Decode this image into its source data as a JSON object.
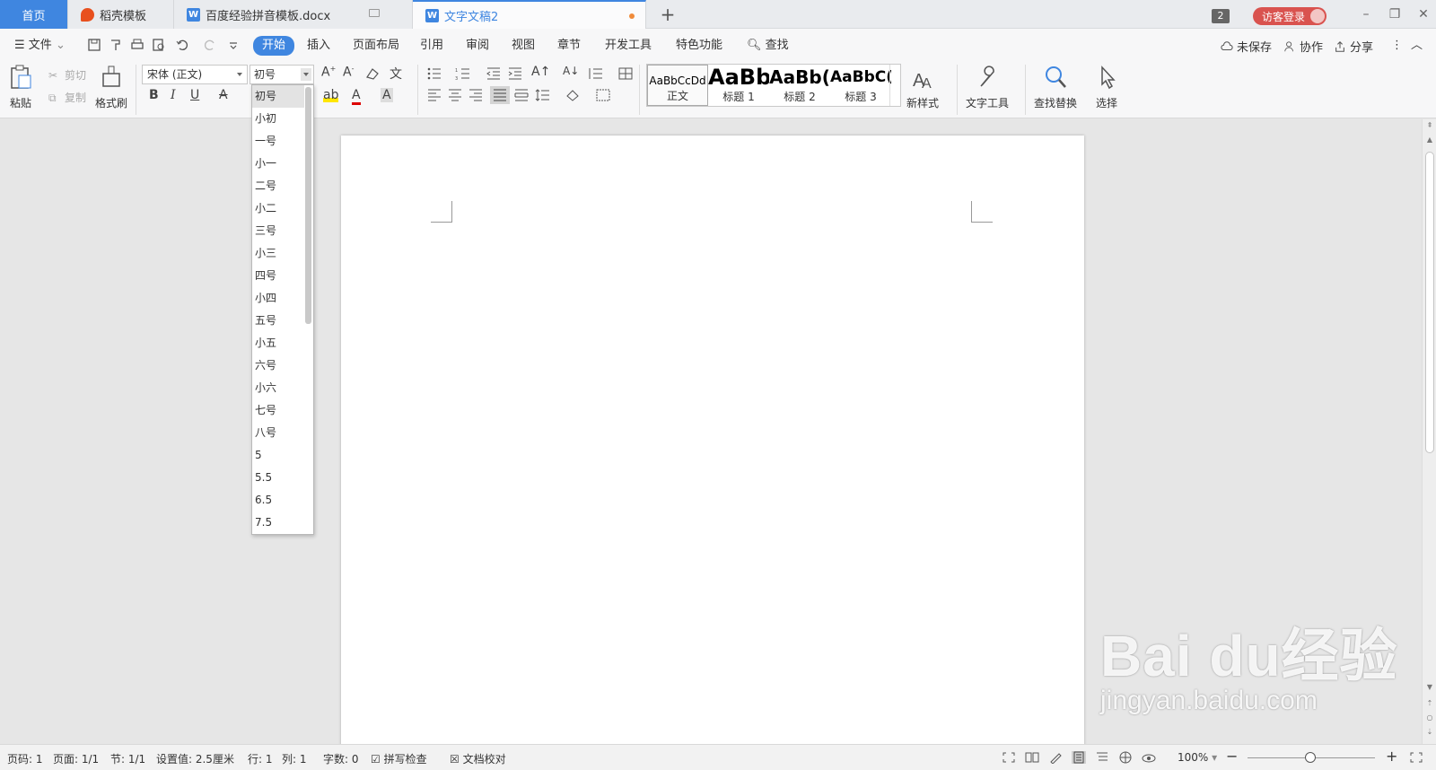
{
  "tabs": [
    {
      "label": "首页"
    },
    {
      "label": "稻壳模板"
    },
    {
      "label": "百度经验拼音模板.docx"
    },
    {
      "label": "文字文稿2"
    }
  ],
  "window": {
    "count_badge": "2",
    "login_label": "访客登录"
  },
  "menu": {
    "file": "文件",
    "items": [
      "开始",
      "插入",
      "页面布局",
      "引用",
      "审阅",
      "视图",
      "章节",
      "开发工具",
      "特色功能"
    ],
    "search": "查找",
    "unsaved": "未保存",
    "collaborate": "协作",
    "share": "分享"
  },
  "ribbon": {
    "paste": "粘贴",
    "cut": "剪切",
    "copy": "复制",
    "format_painter": "格式刷",
    "font_name": "宋体 (正文)",
    "font_size": "初号",
    "styles": [
      {
        "sample": "AaBbCcDd",
        "name": "正文"
      },
      {
        "sample": "AaBb",
        "name": "标题 1"
      },
      {
        "sample": "AaBb(",
        "name": "标题 2"
      },
      {
        "sample": "AaBbC(",
        "name": "标题 3"
      }
    ],
    "new_style": "新样式",
    "text_tools": "文字工具",
    "find_replace": "查找替换",
    "select": "选择"
  },
  "font_size_options": [
    "初号",
    "小初",
    "一号",
    "小一",
    "二号",
    "小二",
    "三号",
    "小三",
    "四号",
    "小四",
    "五号",
    "小五",
    "六号",
    "小六",
    "七号",
    "八号",
    "5",
    "5.5",
    "6.5",
    "7.5"
  ],
  "status": {
    "page": "页码: 1",
    "pages": "页面: 1/1",
    "section": "节: 1/1",
    "setting": "设置值: 2.5厘米",
    "row": "行: 1",
    "col": "列: 1",
    "words": "字数: 0",
    "spell_check": "拼写检查",
    "doc_check": "文档校对",
    "zoom": "100%"
  },
  "watermark": {
    "main": "Bai du经验",
    "sub": "jingyan.baidu.com"
  },
  "colors": {
    "accent": "#3f86e0",
    "login": "#d9534f",
    "modified_dot": "#f08b3a"
  }
}
